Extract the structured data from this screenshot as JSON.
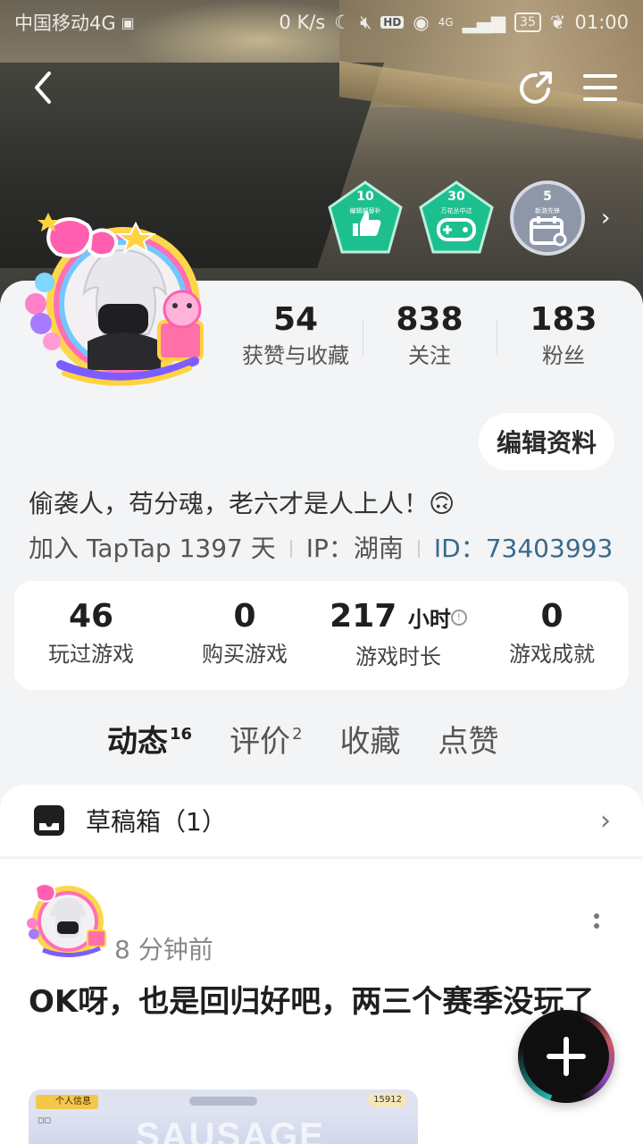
{
  "status_bar": {
    "carrier": "中国移动4G",
    "speed": "0 K/s",
    "hd": "HD",
    "network": "4G",
    "battery": "35",
    "time": "01:00"
  },
  "header": {
    "badges": [
      {
        "num": "10",
        "sub": "编辑部替补",
        "color": "#1dbf8e"
      },
      {
        "num": "30",
        "sub": "万花丛中过",
        "color": "#1dbf8e"
      },
      {
        "num": "5",
        "sub": "新游先锋",
        "color": "#8e97a8"
      }
    ]
  },
  "profile": {
    "stats": [
      {
        "value": "54",
        "label": "获赞与收藏"
      },
      {
        "value": "838",
        "label": "关注"
      },
      {
        "value": "183",
        "label": "粉丝"
      }
    ],
    "edit_label": "编辑资料",
    "bio": "偷袭人，苟分魂，老六才是人上人！🙃",
    "joined": "加入 TapTap 1397 天",
    "ip": "IP：湖南",
    "id": "ID：73403993"
  },
  "game_stats": [
    {
      "value": "46",
      "unit": "",
      "label": "玩过游戏"
    },
    {
      "value": "0",
      "unit": "",
      "label": "购买游戏"
    },
    {
      "value": "217",
      "unit": "小时",
      "label": "游戏时长"
    },
    {
      "value": "0",
      "unit": "",
      "label": "游戏成就"
    }
  ],
  "tabs": [
    {
      "label": "动态",
      "count": "16"
    },
    {
      "label": "评价",
      "count": "2"
    },
    {
      "label": "收藏",
      "count": ""
    },
    {
      "label": "点赞",
      "count": ""
    }
  ],
  "drafts": {
    "label": "草稿箱（1）"
  },
  "post": {
    "time": "8 分钟前",
    "text": "OK呀，也是回归好吧，两三个赛季没玩了",
    "thumb": {
      "tag": "个人信息",
      "score": "15912",
      "logo": "SAUSAGE"
    }
  }
}
